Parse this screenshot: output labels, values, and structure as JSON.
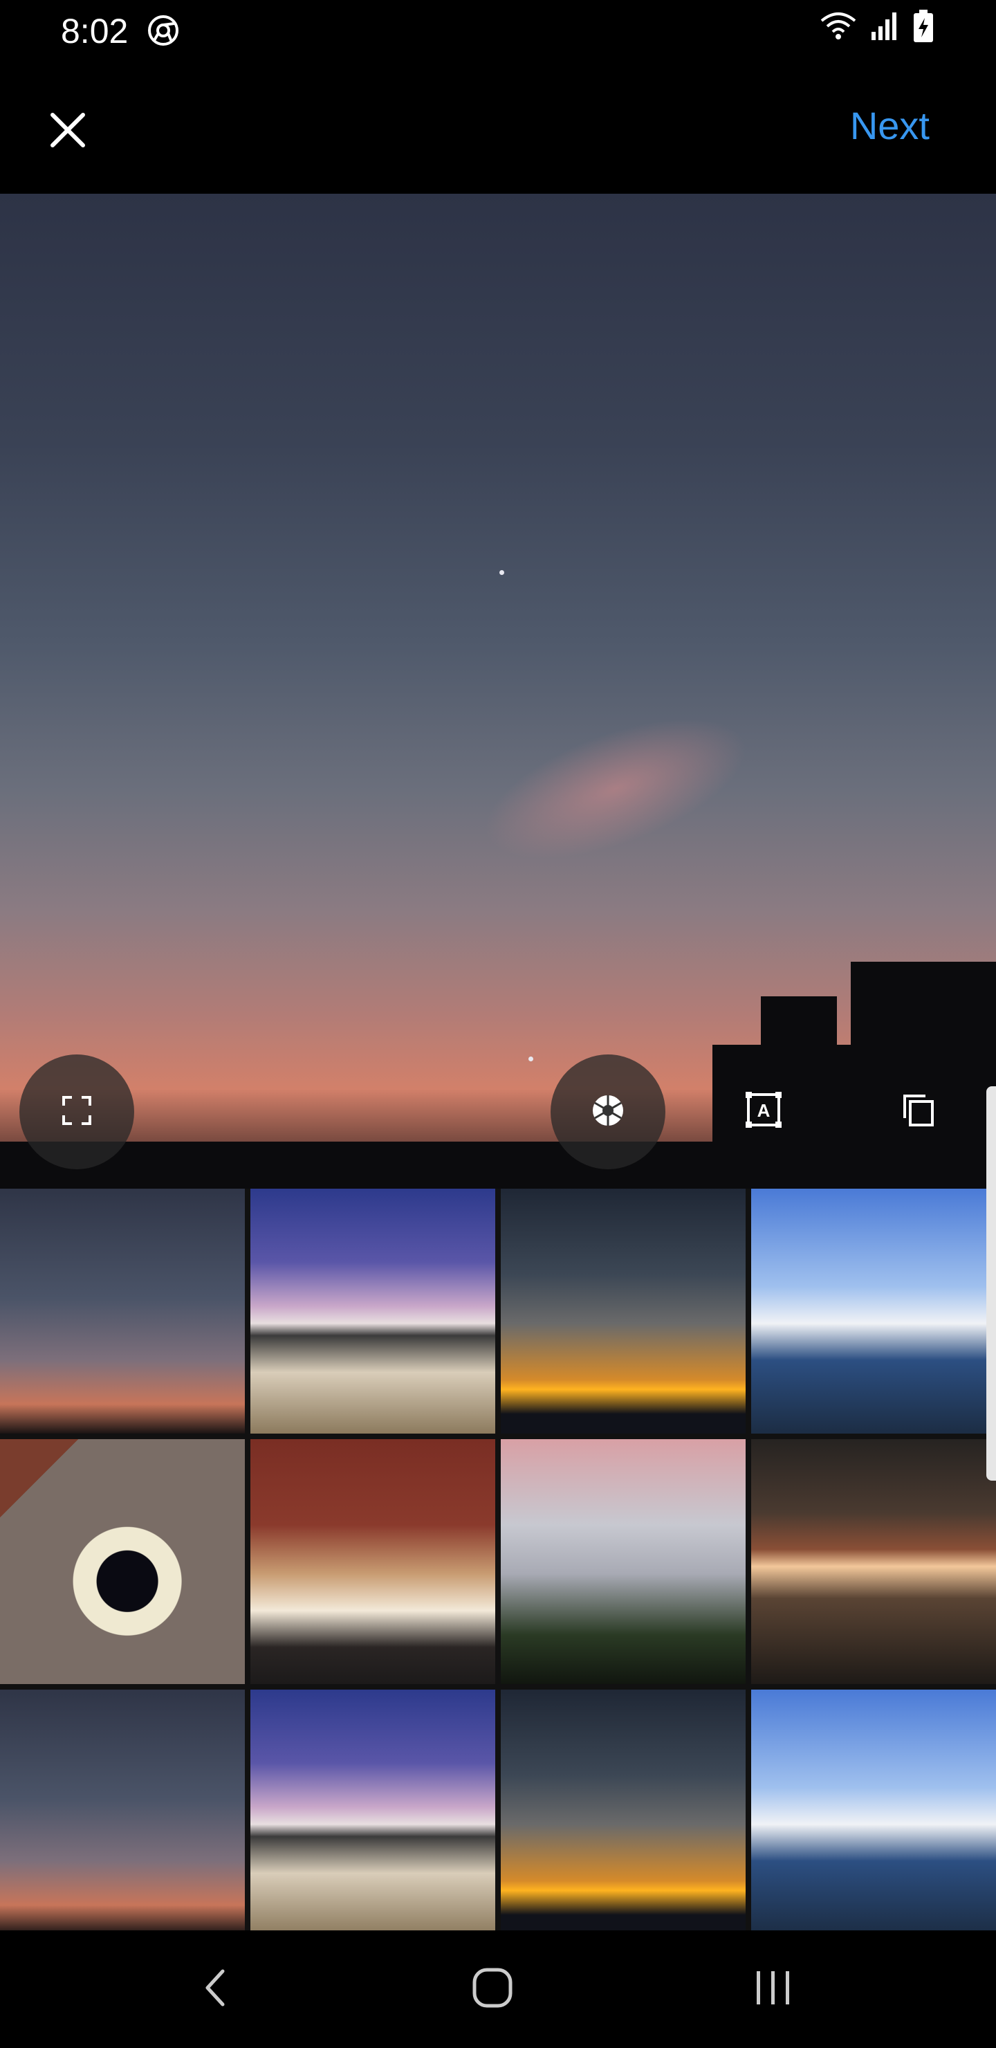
{
  "status_bar": {
    "time": "8:02",
    "app_icon": "chrome-icon",
    "wifi_icon": "wifi-icon",
    "signal_icon": "signal-icon",
    "battery_icon": "battery-charging-icon"
  },
  "top_bar": {
    "close_icon": "close-icon",
    "next_label": "Next"
  },
  "preview": {
    "expand_icon": "expand-icon",
    "boomerang_icon": "aperture-icon",
    "layout_icon": "text-frame-icon",
    "multi_select_icon": "copy-icon"
  },
  "gallery": {
    "thumbnails": [
      "sunset-sky",
      "city-dusk",
      "sunset-horizon",
      "tower-blue-sky",
      "coffee-cup",
      "cafe-table",
      "buildings-pink-sky",
      "restaurant-interior",
      "sunset-sky",
      "city-dusk",
      "sunset-horizon",
      "tower-blue-sky"
    ]
  },
  "nav_bar": {
    "back_icon": "back-icon",
    "home_icon": "home-icon",
    "recents_icon": "recents-icon"
  },
  "colors": {
    "accent": "#3897f0",
    "background": "#000000"
  }
}
